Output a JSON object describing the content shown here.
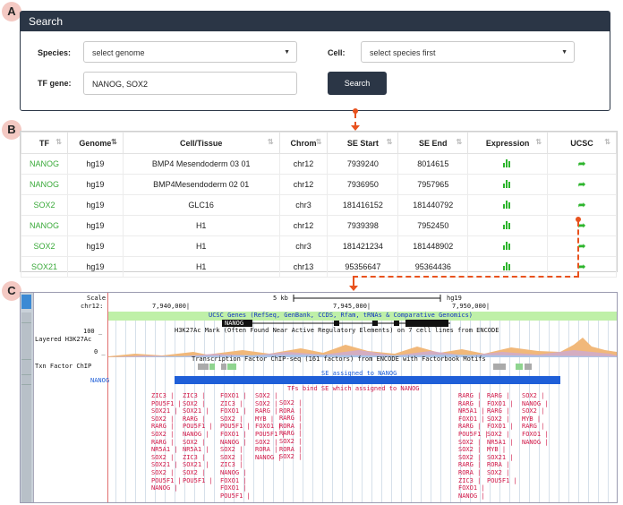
{
  "panel_labels": {
    "a": "A",
    "b": "B",
    "c": "C"
  },
  "search": {
    "title": "Search",
    "species_label": "Species:",
    "species_value": "select genome",
    "cell_label": "Cell:",
    "cell_value": "select species first",
    "tf_label": "TF gene:",
    "tf_value": "NANOG, SOX2",
    "button": "Search"
  },
  "table": {
    "headers": [
      "TF",
      "Genome",
      "Cell/Tissue",
      "Chrom",
      "SE Start",
      "SE End",
      "Expression",
      "UCSC"
    ],
    "rows": [
      {
        "tf": "NANOG",
        "genome": "hg19",
        "cell": "BMP4 Mesendoderm 03 01",
        "chrom": "chr12",
        "start": "7939240",
        "end": "8014615"
      },
      {
        "tf": "NANOG",
        "genome": "hg19",
        "cell": "BMP4Mesendoderm 02 01",
        "chrom": "chr12",
        "start": "7936950",
        "end": "7957965"
      },
      {
        "tf": "SOX2",
        "genome": "hg19",
        "cell": "GLC16",
        "chrom": "chr3",
        "start": "181416152",
        "end": "181440792"
      },
      {
        "tf": "NANOG",
        "genome": "hg19",
        "cell": "H1",
        "chrom": "chr12",
        "start": "7939398",
        "end": "7952450"
      },
      {
        "tf": "SOX2",
        "genome": "hg19",
        "cell": "H1",
        "chrom": "chr3",
        "start": "181421234",
        "end": "181448902"
      },
      {
        "tf": "SOX21",
        "genome": "hg19",
        "cell": "H1",
        "chrom": "chr13",
        "start": "95356647",
        "end": "95364436"
      }
    ]
  },
  "genome": {
    "scale_label": "Scale",
    "chr_label": "chr12:",
    "scale_text": "5 kb",
    "assembly": "hg19",
    "pos1": "7,940,000|",
    "pos2": "7,945,000|",
    "pos3": "7,950,000|",
    "ucsc_genes": "UCSC Genes (RefSeq, GenBank, CCDS, Rfam, tRNAs & Comparative Genomics)",
    "y100": "100 _",
    "layered": "Layered H3K27Ac",
    "y0": "0 _",
    "h3k27_desc": "H3K27Ac Mark (Often Found Near Active Regulatory Elements) on 7 cell lines from ENCODE",
    "gene_name": "NANOG",
    "txn_label": "Txn Factor ChIP",
    "txn_desc": "Transcription Factor ChIP-seq (161 factors) from ENCODE with Factorbook Motifs",
    "nanog_track": "NANOG",
    "se_label": "SE assigned to NANOG",
    "tfbs_title": "TFs bind SE which assigned to NANOG",
    "tf_cols": [
      {
        "key": "c1",
        "items": [
          "ZIC3 |",
          "POU5F1 |",
          "SOX21 |",
          "SOX2 |",
          "RARG |",
          "SOX2 |",
          "RARG |",
          "NR5A1 |",
          "SOX2 |",
          "SOX21 |",
          "SOX2 |",
          "POU5F1 |",
          "NANOG |"
        ]
      },
      {
        "key": "c2",
        "items": [
          "ZIC3 |",
          "SOX2 |",
          "SOX21 |",
          "RARG |",
          "POU5F1 |",
          "NANOG |",
          "SOX2 |",
          "NR5A1 |",
          "ZIC3 |",
          "SOX21 |",
          "SOX2 |",
          "POU5F1 |"
        ]
      },
      {
        "key": "c3",
        "items": [
          "FOXO1 |",
          "ZIC3 |",
          "FOXO1 |",
          "SOX2 |",
          "POU5F1 |",
          "FOXO1 |",
          "NANOG |",
          "SOX2 |",
          "SOX2 |",
          "ZIC3 |",
          "NANOG |",
          "FOXO1 |",
          "FOXO1 |",
          "POU5F1 |"
        ]
      },
      {
        "key": "c4",
        "items": [
          "SOX2 |",
          "SOX2 |",
          "RARG |",
          "MYB |",
          "FOXO1 |",
          "POU5F1 |",
          "SOX2 |",
          "RORA |",
          "NANOG |"
        ]
      },
      {
        "key": "c5",
        "items": [
          "SOX2 |",
          "RORA |",
          "RARG |",
          "RORA |",
          "RARG |",
          "SOX2 |",
          "RORA |",
          "SOX2 |"
        ]
      },
      {
        "key": "c6",
        "items": [
          "RARG |",
          "RARG |",
          "NR5A1 |",
          "FOXO1 |",
          "RARG |",
          "POU5F1 |",
          "SOX2 |",
          "SOX2 |",
          "SOX2 |",
          "RARG |",
          "RORA |",
          "ZIC3 |",
          "FOXO1 |",
          "NANOG |"
        ]
      },
      {
        "key": "c7",
        "items": [
          "RARG |",
          "FOXO1 |",
          "RARG |",
          "SOX2 |",
          "FOXO1 |",
          "SOX2 |",
          "NR5A1 |",
          "MYB |",
          "SOX21 |",
          "RORA |",
          "SOX2 |",
          "POU5F1 |"
        ]
      },
      {
        "key": "c8",
        "items": [
          "SOX2 |",
          "NANOG |",
          "SOX2 |",
          "MYB |",
          "RARG |",
          "FOXO1 |",
          "NANOG |"
        ]
      }
    ]
  },
  "colors": {
    "accent": "#e8521e",
    "tf_text": "#3aaa3a",
    "header_bg": "#2b3646",
    "tfbs_red": "#d01646",
    "se_blue": "#1f5fd8"
  },
  "icons": {
    "expression": "bar-chart-icon",
    "ucsc": "arrow-icon"
  }
}
